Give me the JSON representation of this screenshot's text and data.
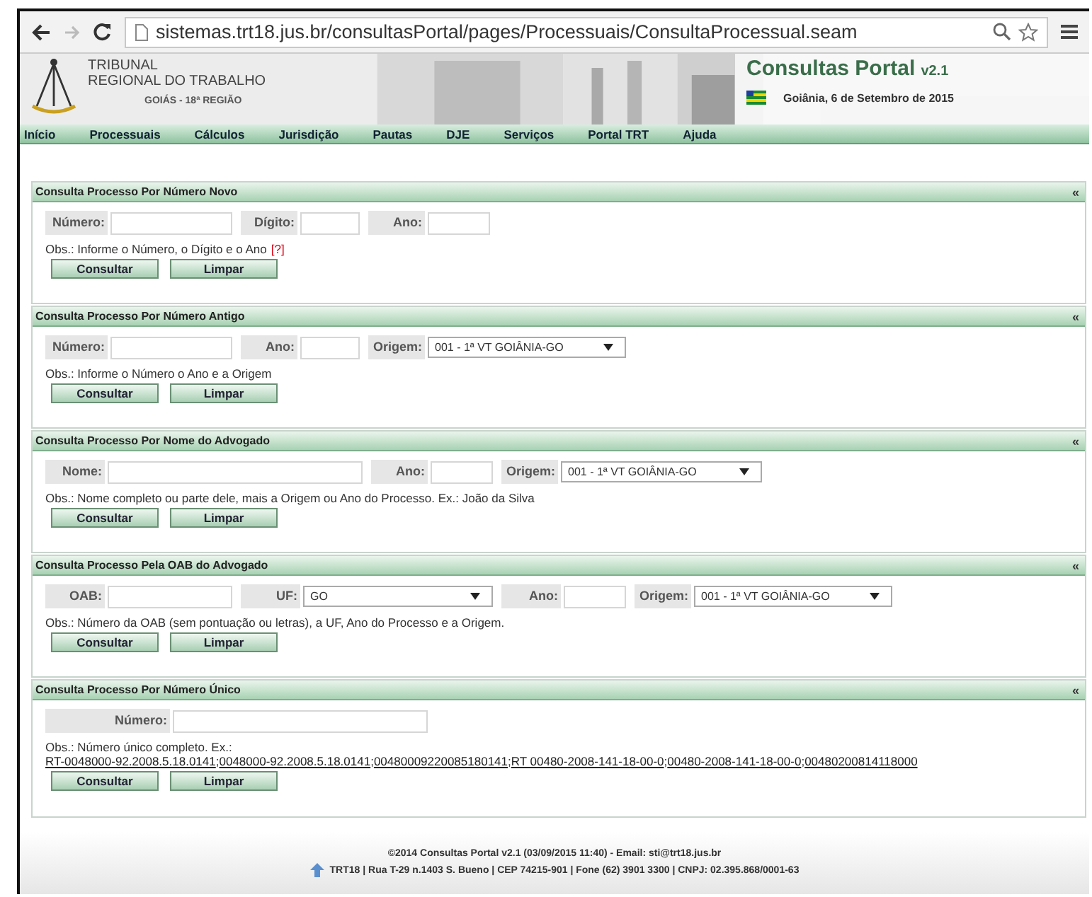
{
  "browser": {
    "url": "sistemas.trt18.jus.br/consultasPortal/pages/Processuais/ConsultaProcessual.seam"
  },
  "header": {
    "court_lines": [
      "TRIBUNAL",
      "REGIONAL DO TRABALHO"
    ],
    "region": "GOIÁS - 18ª REGIÃO",
    "app_title": "Consultas Portal",
    "version": "v2.1",
    "date": "Goiânia, 6 de Setembro de 2015"
  },
  "menu": [
    "Início",
    "Processuais",
    "Cálculos",
    "Jurisdição",
    "Pautas",
    "DJE",
    "Serviços",
    "Portal TRT",
    "Ajuda"
  ],
  "panels": [
    {
      "title": "Consulta Processo Por Número Novo",
      "collapse": "«",
      "fields": [
        {
          "kind": "text",
          "label": "Número:"
        },
        {
          "kind": "text",
          "label": "Dígito:"
        },
        {
          "kind": "text",
          "label": "Ano:"
        }
      ],
      "obs": "Obs.: Informe o Número, o Dígito e o Ano",
      "help": "[?]",
      "buttons": [
        "Consultar",
        "Limpar"
      ]
    },
    {
      "title": "Consulta Processo Por Número Antigo",
      "collapse": "«",
      "fields": [
        {
          "kind": "text",
          "label": "Número:"
        },
        {
          "kind": "text",
          "label": "Ano:"
        },
        {
          "kind": "select",
          "label": "Origem:",
          "value": "001 - 1ª VT GOIÂNIA-GO"
        }
      ],
      "obs": "Obs.: Informe o Número o Ano e a Origem",
      "buttons": [
        "Consultar",
        "Limpar"
      ]
    },
    {
      "title": "Consulta Processo Por Nome do Advogado",
      "collapse": "«",
      "fields": [
        {
          "kind": "text",
          "label": "Nome:"
        },
        {
          "kind": "text",
          "label": "Ano:"
        },
        {
          "kind": "select",
          "label": "Origem:",
          "value": "001 - 1ª VT GOIÂNIA-GO"
        }
      ],
      "obs": "Obs.: Nome completo ou parte dele, mais a Origem ou Ano do Processo. Ex.: João da Silva",
      "buttons": [
        "Consultar",
        "Limpar"
      ]
    },
    {
      "title": "Consulta Processo Pela OAB do Advogado",
      "collapse": "«",
      "fields": [
        {
          "kind": "text",
          "label": "OAB:"
        },
        {
          "kind": "select",
          "label": "UF:",
          "value": "GO"
        },
        {
          "kind": "text",
          "label": "Ano:"
        },
        {
          "kind": "select",
          "label": "Origem:",
          "value": "001 - 1ª VT GOIÂNIA-GO"
        }
      ],
      "obs": "Obs.: Número da OAB (sem pontuação ou letras), a UF, Ano do Processo e a Origem.",
      "buttons": [
        "Consultar",
        "Limpar"
      ]
    },
    {
      "title": "Consulta Processo Por Número Único",
      "collapse": "«",
      "fields": [
        {
          "kind": "text",
          "label": "Número:"
        }
      ],
      "obs": "Obs.: Número único completo. Ex.:",
      "separator": ";",
      "examples": [
        "RT-0048000-92.2008.5.18.0141",
        "0048000-92.2008.5.18.0141",
        "00480009220085180141",
        "RT 00480-2008-141-18-00-0",
        "00480-2008-141-18-00-0",
        "00480200814118000"
      ],
      "buttons": [
        "Consultar",
        "Limpar"
      ]
    }
  ],
  "footer": {
    "line_1": "©2014 Consultas Portal v2.1 (03/09/2015 11:40) - Email: sti@trt18.jus.br",
    "line_2": "TRT18 | Rua T-29 n.1403 S. Bueno | CEP 74215-901 | Fone (62) 3901 3300 | CNPJ: 02.395.868/0001-63"
  }
}
